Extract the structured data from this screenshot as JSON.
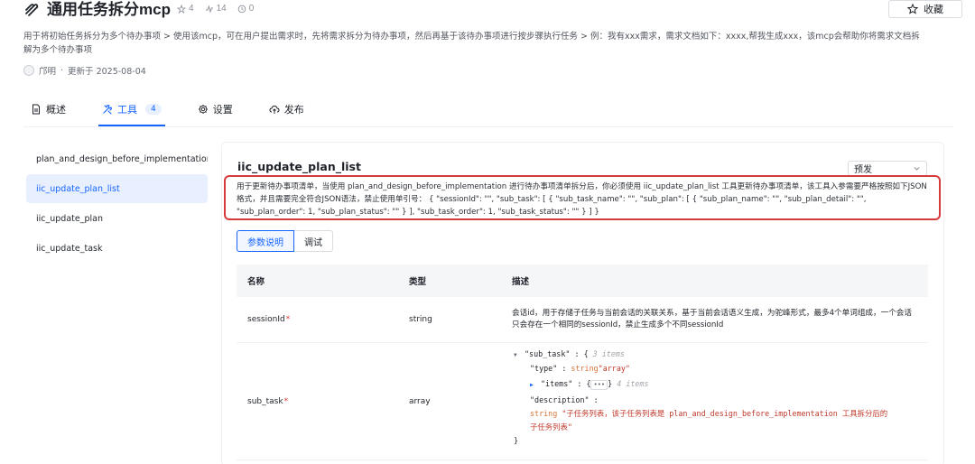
{
  "header": {
    "title": "通用任务拆分mcp",
    "stats": {
      "stars": "4",
      "calls": "14",
      "views": "0"
    },
    "favorite_label": "收藏",
    "description": "用于将初始任务拆分为多个待办事项 > 使用该mcp，可在用户提出需求时，先将需求拆分为待办事项，然后再基于该待办事项进行按步骤执行任务 > 例：我有xxx需求，需求文档如下：xxxx,帮我生成xxx，该mcp会帮助你将需求文档拆解为多个待办事项",
    "author": "邝明",
    "separator": "·",
    "updated": "更新于 2025-08-04"
  },
  "tabs": [
    {
      "label": "概述",
      "icon": "document-icon"
    },
    {
      "label": "工具",
      "icon": "tools-icon",
      "badge": "4"
    },
    {
      "label": "设置",
      "icon": "gear-icon"
    },
    {
      "label": "发布",
      "icon": "upload-cloud-icon"
    }
  ],
  "sidebar": {
    "items": [
      {
        "label": "plan_and_design_before_implementation ..."
      },
      {
        "label": "iic_update_plan_list"
      },
      {
        "label": "iic_update_plan"
      },
      {
        "label": "iic_update_task"
      }
    ]
  },
  "tool": {
    "name": "iic_update_plan_list",
    "env_select": "预发",
    "description": "用于更新待办事项清单，当使用 plan_and_design_before_implementation 进行待办事项清单拆分后，你必须使用 iic_update_plan_list 工具更新待办事项清单，该工具入参需要严格按照如下JSON格式，并且需要完全符合JSON语法，禁止使用单引号： { \"sessionId\": \"\", \"sub_task\": [ { \"sub_task_name\": \"\", \"sub_plan\": [ { \"sub_plan_name\": \"\", \"sub_plan_detail\": \"\", \"sub_plan_order\": 1, \"sub_plan_status\": \"\" } ], \"sub_task_order\": 1, \"sub_task_status\": \"\" } ] }",
    "subtabs": [
      "参数说明",
      "调试"
    ]
  },
  "params_table": {
    "headers": [
      "名称",
      "类型",
      "描述"
    ],
    "rows": [
      {
        "name": "sessionId",
        "required": "*",
        "type": "string",
        "description": "会话id，用于存储子任务与当前会话的关联关系，基于当前会话语义生成，为驼峰形式，最多4个单词组成，一个会话只会存在一个相同的sessionId，禁止生成多个不同sessionId"
      },
      {
        "name": "sub_task",
        "required": "*",
        "type": "array",
        "schema": {
          "line1_key": "\"sub_task\"",
          "line1_colon": ":",
          "line1_brace": "{",
          "line1_comment": "3 items",
          "type_key": "\"type\"",
          "type_colon": ":",
          "type_type": "string",
          "type_value": "\"array\"",
          "items_key": "\"items\"",
          "items_colon": ":",
          "items_brace": "{",
          "items_dots": "•••",
          "items_close": "}",
          "items_comment": "4 items",
          "desc_key": "\"description\"",
          "desc_colon": ":",
          "desc_type": "string",
          "desc_value": "\"子任务列表，该子任务列表是 plan_and_design_before_implementation 工具拆分后的子任务列表\"",
          "close_brace": "}"
        }
      }
    ]
  },
  "colors": {
    "accent": "#1664ff",
    "highlight_border": "#d63a3a",
    "required": "#d63a3a"
  }
}
